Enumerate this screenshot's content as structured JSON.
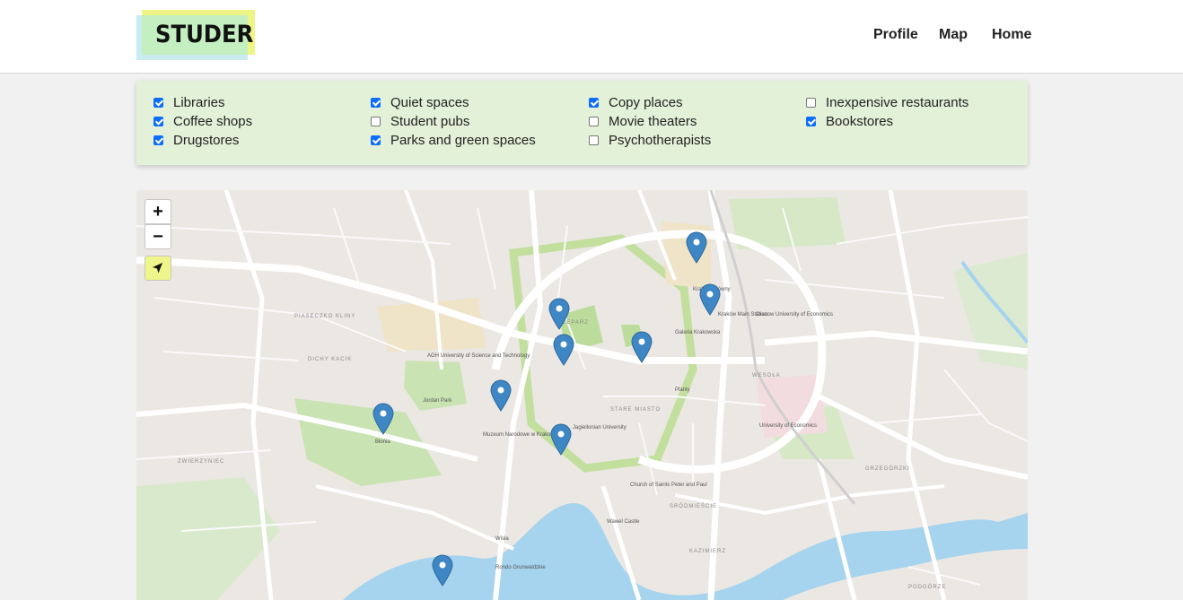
{
  "header": {
    "logo_text": "STUDER",
    "nav": {
      "profile": "Profile",
      "map": "Map",
      "home": "Home"
    }
  },
  "filters": [
    {
      "label": "Libraries",
      "checked": true
    },
    {
      "label": "Coffee shops",
      "checked": true
    },
    {
      "label": "Drugstores",
      "checked": true
    },
    {
      "label": "Quiet spaces",
      "checked": true
    },
    {
      "label": "Student pubs",
      "checked": false
    },
    {
      "label": "Parks and green spaces",
      "checked": true
    },
    {
      "label": "Copy places",
      "checked": true
    },
    {
      "label": "Movie theaters",
      "checked": false
    },
    {
      "label": "Psychotherapists",
      "checked": false
    },
    {
      "label": "Inexpensive restaurants",
      "checked": false
    },
    {
      "label": "Bookstores",
      "checked": true
    }
  ],
  "map": {
    "controls": {
      "zoom_in": "+",
      "zoom_out": "−"
    },
    "districts": [
      "PIASECZKO KLINY",
      "DICHY KACIK",
      "ZWIERZYNIEC",
      "KLEPARZ",
      "STARE MIASTO",
      "WESOŁA",
      "GRZEGÓRZKI",
      "KAZIMIERZ",
      "PODGÓRZE",
      "SRÓDMIEŚCIE"
    ],
    "labels": [
      "Jordan Park",
      "Błonia",
      "Muzeum Narodowe w Krakowie",
      "Wawel Castle",
      "Kraków Main Station",
      "Galeria Krakowska",
      "University of Economics",
      "AGH University of Science and Technology",
      "Jagiellonian University",
      "Planty",
      "Kraków Glówny",
      "Church of Saints Peter and Paul",
      "Wisła",
      "Rondo Grunwaldzkie",
      "Cracow University of Economics"
    ],
    "marker_color": "#3f86c4"
  }
}
